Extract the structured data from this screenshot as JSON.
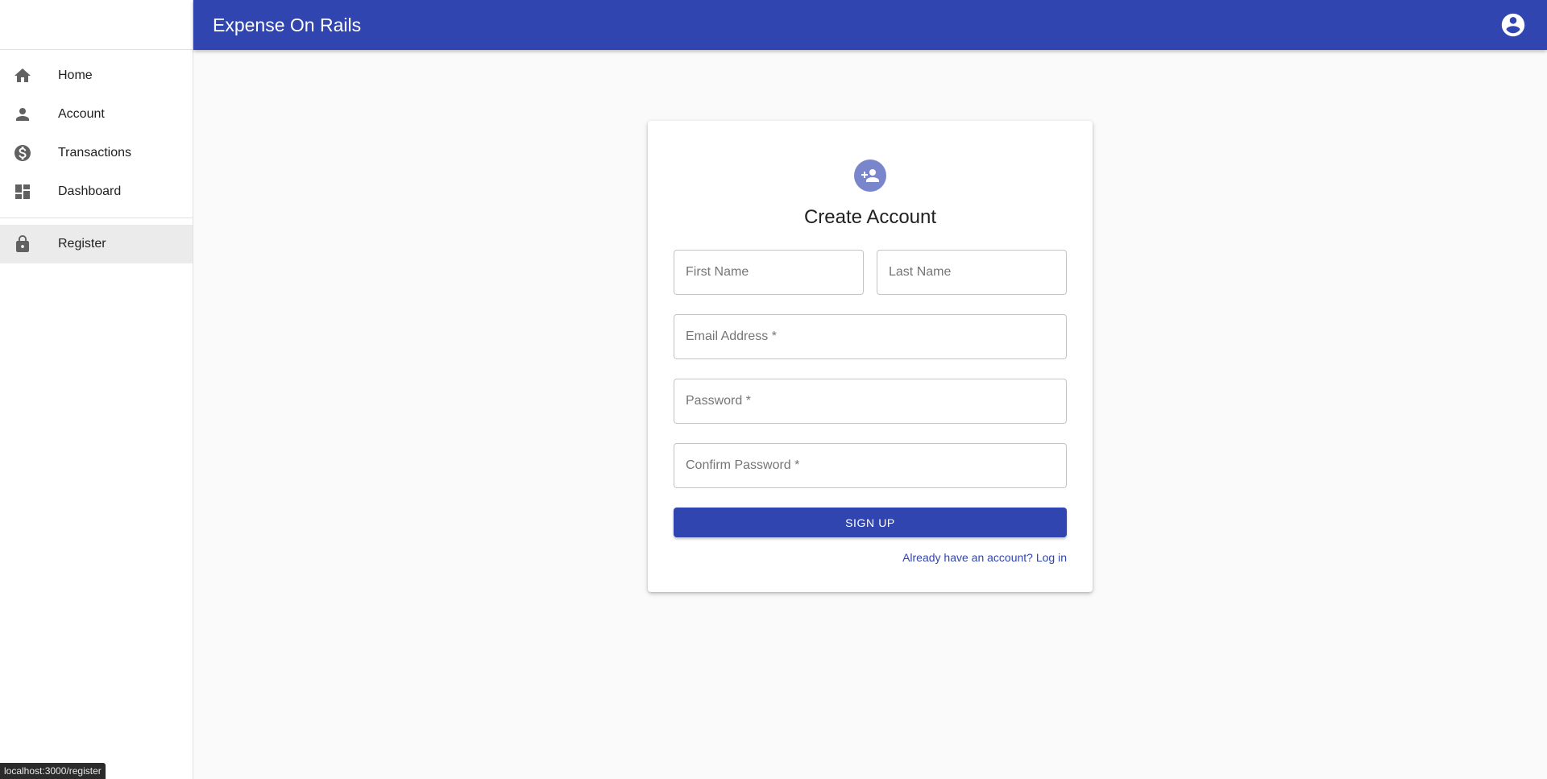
{
  "app": {
    "title": "Expense On Rails"
  },
  "header": {
    "account_icon": "account-circle-icon"
  },
  "sidebar": {
    "items": [
      {
        "label": "Home",
        "icon": "home-icon"
      },
      {
        "label": "Account",
        "icon": "person-icon"
      },
      {
        "label": "Transactions",
        "icon": "dollar-icon"
      },
      {
        "label": "Dashboard",
        "icon": "dashboard-icon"
      }
    ],
    "secondary": [
      {
        "label": "Register",
        "icon": "lock-icon",
        "selected": true
      }
    ]
  },
  "form": {
    "icon": "person-add-icon",
    "title": "Create Account",
    "first_name_placeholder": "First Name",
    "last_name_placeholder": "Last Name",
    "email_placeholder": "Email Address *",
    "password_placeholder": "Password *",
    "confirm_password_placeholder": "Confirm Password *",
    "submit_label": "Sign Up",
    "login_link": "Already have an account? Log in"
  },
  "statusbar": {
    "url": "localhost:3000/register"
  },
  "colors": {
    "primary": "#3045b0",
    "avatar": "#7986cb",
    "selected_bg": "#ebebeb"
  }
}
